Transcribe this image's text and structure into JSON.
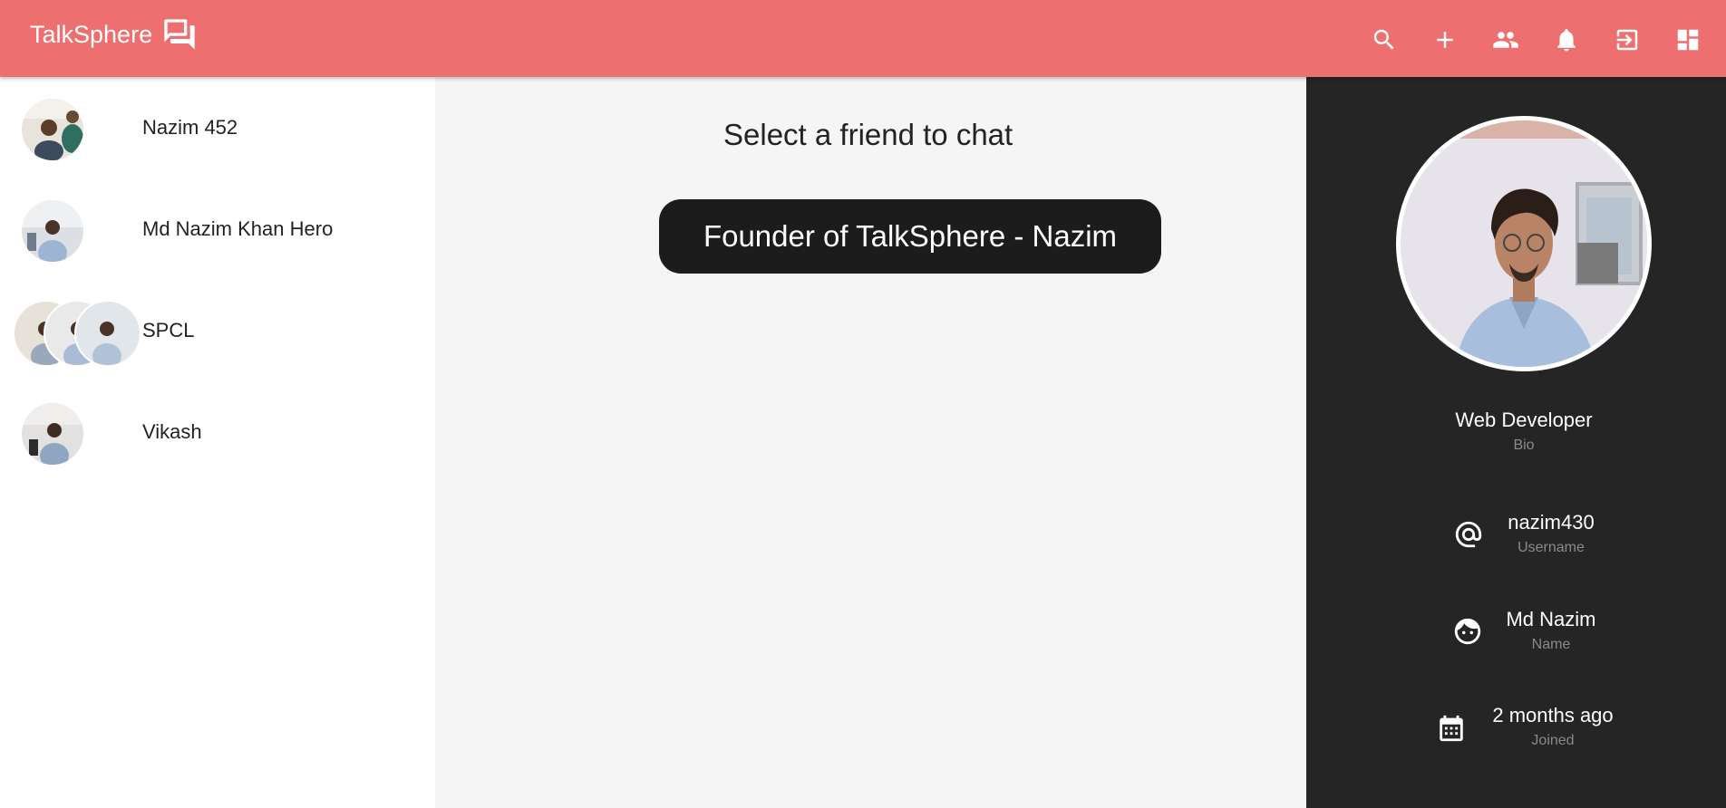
{
  "app": {
    "title": "TalkSphere"
  },
  "header": {
    "actions": [
      {
        "name": "search-icon",
        "label": "Search"
      },
      {
        "name": "add-icon",
        "label": "Add"
      },
      {
        "name": "people-icon",
        "label": "Friends"
      },
      {
        "name": "bell-icon",
        "label": "Notifications"
      },
      {
        "name": "logout-icon",
        "label": "Logout"
      },
      {
        "name": "dashboard-icon",
        "label": "Dashboard"
      }
    ]
  },
  "sidebar": {
    "friends": [
      {
        "name": "Nazim 452"
      },
      {
        "name": "Md Nazim Khan Hero"
      },
      {
        "name": "SPCL"
      },
      {
        "name": "Vikash"
      }
    ]
  },
  "main": {
    "prompt": "Select a friend to chat",
    "founder_banner": "Founder of TalkSphere - Nazim"
  },
  "profile": {
    "bio": {
      "value": "Web Developer",
      "label": "Bio"
    },
    "username": {
      "value": "nazim430",
      "label": "Username"
    },
    "name": {
      "value": "Md Nazim",
      "label": "Name"
    },
    "joined": {
      "value": "2 months ago",
      "label": "Joined"
    }
  },
  "colors": {
    "appbar": "#ed6f6f",
    "profile_panel": "#252525",
    "founder_banner": "#1c1c1c"
  }
}
